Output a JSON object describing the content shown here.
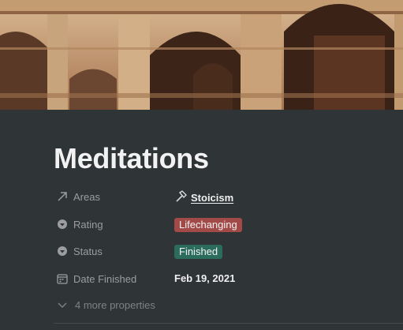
{
  "cover": {
    "description": "colosseum-arches-photo",
    "icon": "colosseum-cover-image"
  },
  "page": {
    "title": "Meditations"
  },
  "properties": [
    {
      "label": "Areas",
      "icon": "arrow-up-right-icon",
      "value": "Stoicism",
      "value_icon": "hammer-icon",
      "type": "relation"
    },
    {
      "label": "Rating",
      "icon": "select-caret-icon",
      "value": "Lifechanging",
      "type": "select",
      "color": "#a24a47"
    },
    {
      "label": "Status",
      "icon": "select-caret-icon",
      "value": "Finished",
      "type": "select",
      "color": "#2b6c5c"
    },
    {
      "label": "Date Finished",
      "icon": "calendar-icon",
      "value": "Feb 19, 2021",
      "type": "date"
    }
  ],
  "more_properties": {
    "label": "4 more properties",
    "icon": "chevron-down-icon"
  }
}
